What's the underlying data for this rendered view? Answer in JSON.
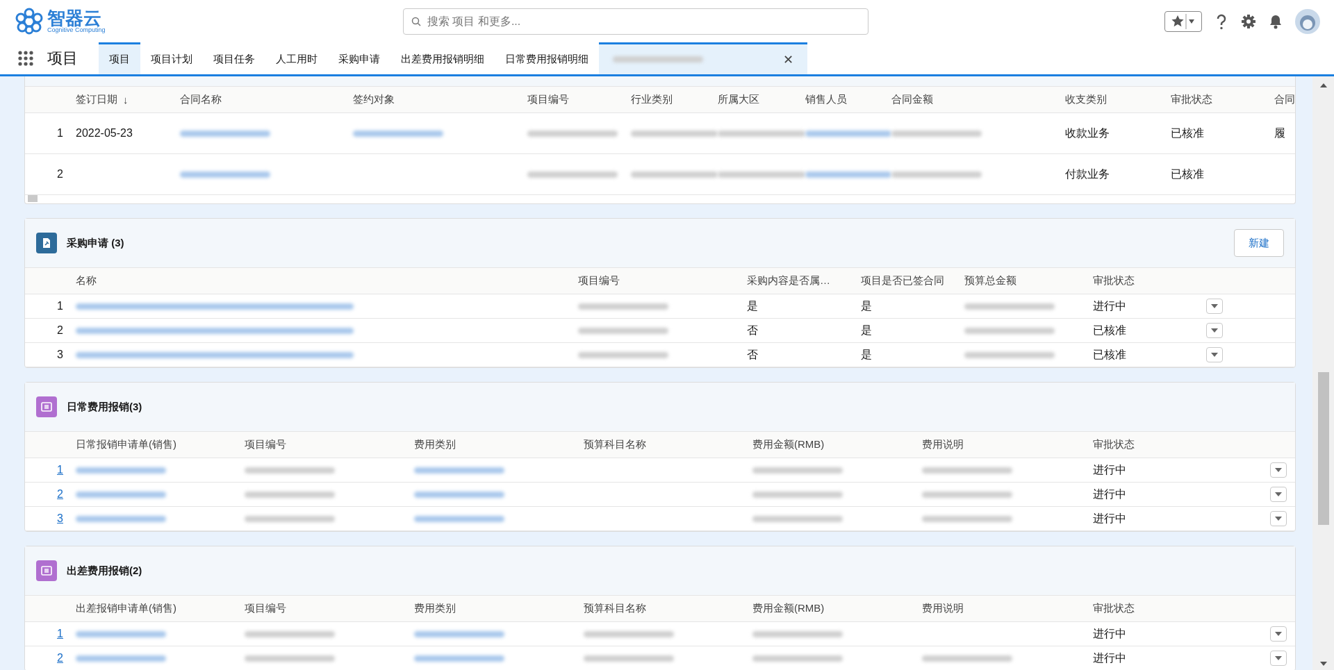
{
  "header": {
    "logo_name": "智器云",
    "logo_tagline": "Cognitive Computing",
    "search": {
      "placeholder": "搜索 项目 和更多..."
    }
  },
  "nav": {
    "app_name": "项目",
    "tabs": [
      {
        "label": "项目",
        "selected": true
      },
      {
        "label": "项目计划",
        "selected": false
      },
      {
        "label": "项目任务",
        "selected": false
      },
      {
        "label": "人工用时",
        "selected": false
      },
      {
        "label": "采购申请",
        "selected": false
      },
      {
        "label": "出差费用报销明细",
        "selected": false
      },
      {
        "label": "日常费用报销明细",
        "selected": false
      },
      {
        "redacted": true,
        "closable": true,
        "close": "✕",
        "selected": true
      }
    ]
  },
  "sections": [
    {
      "kind": "contracts",
      "columns": [
        {
          "label": "签订日期",
          "sort": "↓"
        },
        {
          "label": "合同名称"
        },
        {
          "label": "签约对象"
        },
        {
          "label": "项目编号"
        },
        {
          "label": "行业类别"
        },
        {
          "label": "所属大区"
        },
        {
          "label": "销售人员"
        },
        {
          "label": "合同金额"
        },
        {
          "label": "收支类别"
        },
        {
          "label": "审批状态"
        },
        {
          "label": "合同"
        }
      ],
      "rows": [
        {
          "num": "1",
          "cells": [
            {
              "text": "2022-05-23"
            },
            {
              "redacted": true,
              "link": true
            },
            {
              "redacted": true,
              "link": true
            },
            {
              "redacted": true,
              "link": false
            },
            {
              "redacted": true,
              "link": false
            },
            {
              "redacted": true,
              "link": false
            },
            {
              "redacted": true,
              "link": true
            },
            {
              "redacted": true,
              "link": false
            },
            {
              "text": "收款业务"
            },
            {
              "text": "已核准"
            },
            {
              "text": "履"
            }
          ]
        },
        {
          "num": "2",
          "cells": [
            {},
            {
              "redacted": true,
              "link": true
            },
            {},
            {
              "redacted": true,
              "link": false
            },
            {
              "redacted": true,
              "link": false
            },
            {
              "redacted": true,
              "link": false
            },
            {
              "redacted": true,
              "link": true
            },
            {
              "redacted": true,
              "link": false
            },
            {
              "text": "付款业务"
            },
            {
              "text": "已核准"
            },
            {}
          ]
        }
      ]
    },
    {
      "kind": "procurement",
      "title": "采购申请 (3)",
      "new_button": "新建",
      "columns": [
        {
          "label": "名称"
        },
        {
          "label": "项目编号"
        },
        {
          "label": "采购内容是否属…"
        },
        {
          "label": "项目是否已签合同"
        },
        {
          "label": "预算总金额"
        },
        {
          "label": "审批状态"
        },
        {}
      ],
      "rows": [
        {
          "num": "1",
          "cells": [
            {
              "redacted": true,
              "link": true
            },
            {
              "redacted": true,
              "link": false
            },
            {
              "text": "是"
            },
            {
              "text": "是"
            },
            {
              "redacted": true,
              "link": false
            },
            {
              "text": "进行中"
            },
            {
              "menu": true
            }
          ]
        },
        {
          "num": "2",
          "cells": [
            {
              "redacted": true,
              "link": true
            },
            {
              "redacted": true,
              "link": false
            },
            {
              "text": "否"
            },
            {
              "text": "是"
            },
            {
              "redacted": true,
              "link": false
            },
            {
              "text": "已核准"
            },
            {
              "menu": true
            }
          ]
        },
        {
          "num": "3",
          "cells": [
            {
              "redacted": true,
              "link": true
            },
            {
              "redacted": true,
              "link": false
            },
            {
              "text": "否"
            },
            {
              "text": "是"
            },
            {
              "redacted": true,
              "link": false
            },
            {
              "text": "已核准"
            },
            {
              "menu": true
            }
          ]
        }
      ]
    },
    {
      "kind": "expense",
      "title": "日常费用报销(3)",
      "columns": [
        {
          "label": "日常报销申请单(销售)"
        },
        {
          "label": "项目编号"
        },
        {
          "label": "费用类别"
        },
        {
          "label": "预算科目名称"
        },
        {
          "label": "费用金额(RMB)"
        },
        {
          "label": "费用说明"
        },
        {
          "label": "审批状态"
        },
        {}
      ],
      "rows": [
        {
          "num": "1",
          "link_num": true,
          "cells": [
            {
              "redacted": true,
              "link": true
            },
            {
              "redacted": true,
              "link": false
            },
            {
              "redacted": true,
              "link": true
            },
            {},
            {
              "redacted": true,
              "link": false
            },
            {
              "redacted": true,
              "link": false
            },
            {
              "text": "进行中"
            },
            {
              "menu": true
            }
          ]
        },
        {
          "num": "2",
          "link_num": true,
          "cells": [
            {
              "redacted": true,
              "link": true
            },
            {
              "redacted": true,
              "link": false
            },
            {
              "redacted": true,
              "link": true
            },
            {},
            {
              "redacted": true,
              "link": false
            },
            {
              "redacted": true,
              "link": false
            },
            {
              "text": "进行中"
            },
            {
              "menu": true
            }
          ]
        },
        {
          "num": "3",
          "link_num": true,
          "cells": [
            {
              "redacted": true,
              "link": true
            },
            {
              "redacted": true,
              "link": false
            },
            {
              "redacted": true,
              "link": true
            },
            {},
            {
              "redacted": true,
              "link": false
            },
            {
              "redacted": true,
              "link": false
            },
            {
              "text": "进行中"
            },
            {
              "menu": true
            }
          ]
        }
      ]
    },
    {
      "kind": "expense",
      "title": "出差费用报销(2)",
      "columns": [
        {
          "label": "出差报销申请单(销售)"
        },
        {
          "label": "项目编号"
        },
        {
          "label": "费用类别"
        },
        {
          "label": "预算科目名称"
        },
        {
          "label": "费用金额(RMB)"
        },
        {
          "label": "费用说明"
        },
        {
          "label": "审批状态"
        },
        {}
      ],
      "rows": [
        {
          "num": "1",
          "link_num": true,
          "cells": [
            {
              "redacted": true,
              "link": true
            },
            {
              "redacted": true,
              "link": false
            },
            {
              "redacted": true,
              "link": true
            },
            {
              "redacted": true,
              "link": false
            },
            {
              "redacted": true,
              "link": false
            },
            {},
            {
              "text": "进行中"
            },
            {
              "menu": true
            }
          ]
        },
        {
          "num": "2",
          "link_num": true,
          "cells": [
            {
              "redacted": true,
              "link": true
            },
            {
              "redacted": true,
              "link": false
            },
            {
              "redacted": true,
              "link": true
            },
            {
              "redacted": true,
              "link": false
            },
            {
              "redacted": true,
              "link": false
            },
            {
              "redacted": true,
              "link": false
            },
            {
              "text": "进行中"
            },
            {
              "menu": true
            }
          ]
        }
      ]
    }
  ]
}
